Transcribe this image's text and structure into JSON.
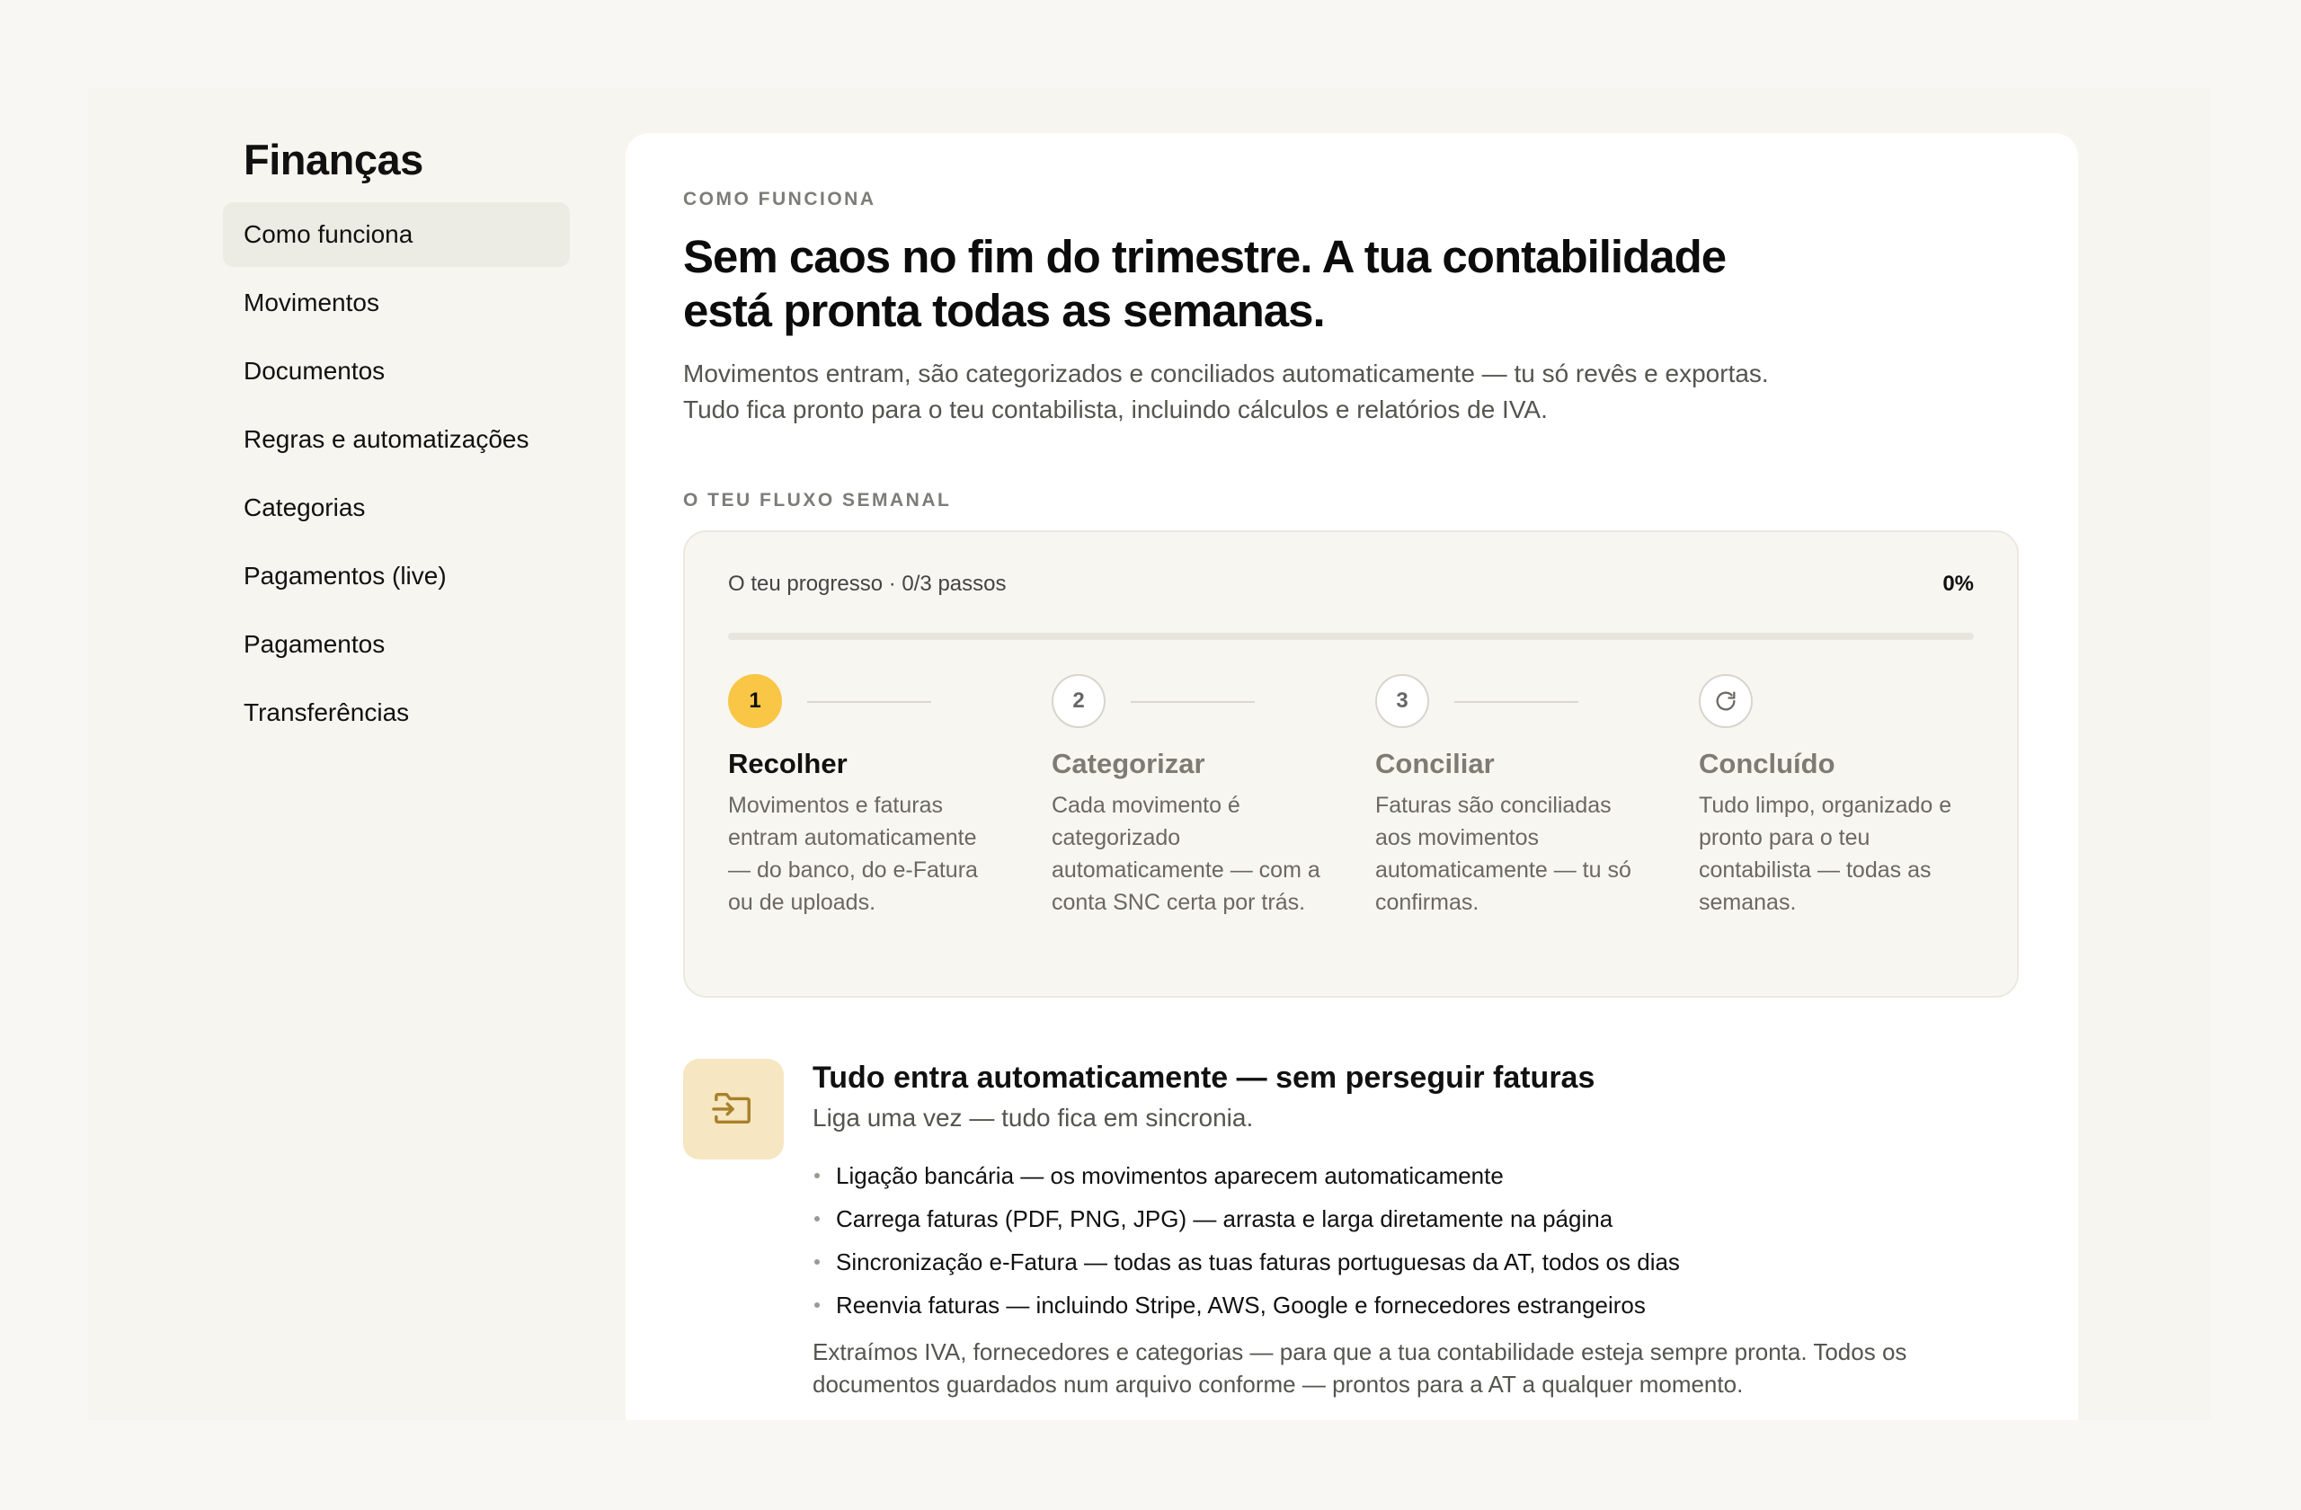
{
  "sidebar": {
    "title": "Finanças",
    "items": [
      {
        "label": "Como funciona",
        "active": true
      },
      {
        "label": "Movimentos"
      },
      {
        "label": "Documentos"
      },
      {
        "label": "Regras e automatizações"
      },
      {
        "label": "Categorias"
      },
      {
        "label": "Pagamentos (live)"
      },
      {
        "label": "Pagamentos"
      },
      {
        "label": "Transferências"
      }
    ]
  },
  "main": {
    "eyebrow": "COMO FUNCIONA",
    "title_line1": "Sem caos no fim do trimestre. A tua contabilidade",
    "title_line2": "está pronta todas as semanas.",
    "subtitle_line1": "Movimentos entram, são categorizados e conciliados automaticamente — tu só revês e exportas.",
    "subtitle_line2": "Tudo fica pronto para o teu contabilista, incluindo cálculos e relatórios de IVA.",
    "flow_eyebrow": "O TEU FLUXO SEMANAL"
  },
  "progress": {
    "label": "O teu progresso · 0/3 passos",
    "percent_text": "0%",
    "value": 0,
    "steps": [
      {
        "number": "1",
        "title": "Recolher",
        "description": "Movimentos e faturas entram automaticamente — do banco, do e-Fatura ou de uploads.",
        "active": true
      },
      {
        "number": "2",
        "title": "Categorizar",
        "description": "Cada movimento é categorizado automaticamente — com a conta SNC certa por trás."
      },
      {
        "number": "3",
        "title": "Conciliar",
        "description": "Faturas são conciliadas aos movimentos automaticamente — tu só confirmas."
      },
      {
        "icon": "refresh-icon",
        "title": "Concluído",
        "description": "Tudo limpo, organizado e pronto para o teu contabilista — todas as semanas."
      }
    ]
  },
  "feature": {
    "icon": "folder-import-icon",
    "title": "Tudo entra automaticamente — sem perseguir faturas",
    "subtitle": "Liga uma vez — tudo fica em sincronia.",
    "bullets": [
      "Ligação bancária — os movimentos aparecem automaticamente",
      "Carrega faturas (PDF, PNG, JPG) — arrasta e larga diretamente na página",
      "Sincronização e-Fatura — todas as tuas faturas portuguesas da AT, todos os dias",
      "Reenvia faturas — incluindo Stripe, AWS, Google e fornecedores estrangeiros"
    ],
    "note": "Extraímos IVA, fornecedores e categorias — para que a tua contabilidade esteja sempre pronta. Todos os documentos guardados num arquivo conforme — prontos para a AT a qualquer momento."
  },
  "colors": {
    "accent": "#f9c646",
    "icon_bg": "#f6e6c1",
    "icon_stroke": "#a8802a",
    "active_nav_bg": "#ecebe4"
  }
}
